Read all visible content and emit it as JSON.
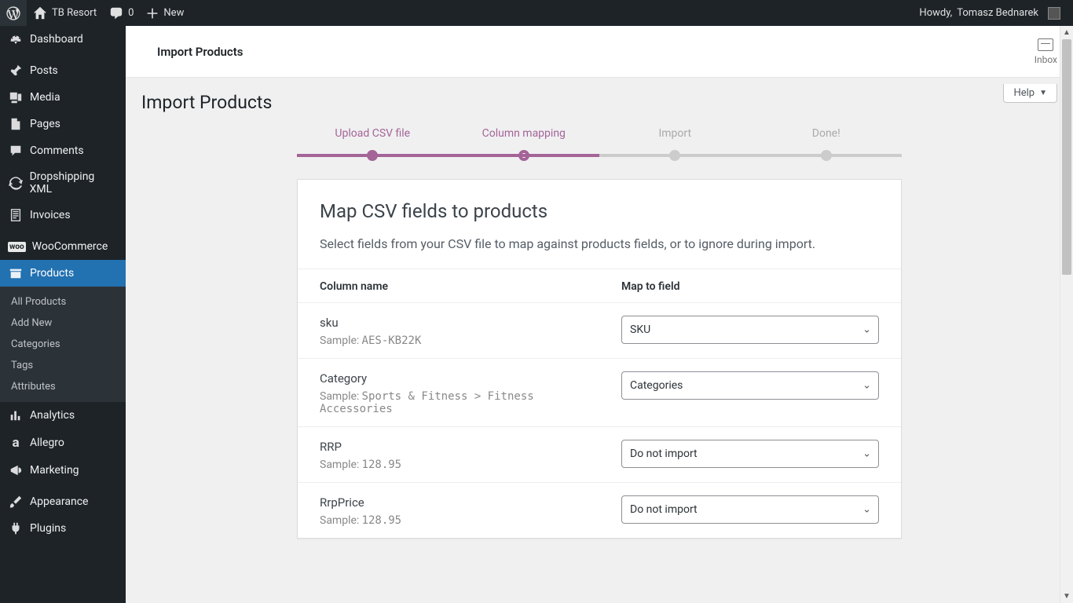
{
  "adminbar": {
    "site_name": "TB Resort",
    "comments_count": "0",
    "new_label": "New",
    "howdy_prefix": "Howdy, ",
    "user_display": "Tomasz Bednarek"
  },
  "sidebar": {
    "items": [
      {
        "label": "Dashboard",
        "icon": "dashboard"
      },
      {
        "label": "Posts",
        "icon": "pin"
      },
      {
        "label": "Media",
        "icon": "media"
      },
      {
        "label": "Pages",
        "icon": "page"
      },
      {
        "label": "Comments",
        "icon": "comment"
      },
      {
        "label": "Dropshipping XML",
        "icon": "refresh"
      },
      {
        "label": "Invoices",
        "icon": "invoice"
      },
      {
        "label": "WooCommerce",
        "icon": "woo"
      },
      {
        "label": "Products",
        "icon": "products",
        "current": true
      },
      {
        "label": "Analytics",
        "icon": "analytics"
      },
      {
        "label": "Allegro",
        "icon": "allegro"
      },
      {
        "label": "Marketing",
        "icon": "marketing"
      },
      {
        "label": "Appearance",
        "icon": "appearance"
      },
      {
        "label": "Plugins",
        "icon": "plugins"
      }
    ],
    "products_submenu": [
      {
        "label": "All Products"
      },
      {
        "label": "Add New"
      },
      {
        "label": "Categories"
      },
      {
        "label": "Tags"
      },
      {
        "label": "Attributes"
      }
    ]
  },
  "header": {
    "title": "Import Products",
    "inbox_label": "Inbox",
    "help_label": "Help"
  },
  "page": {
    "title": "Import Products"
  },
  "steps": [
    {
      "label": "Upload CSV file",
      "state": "done"
    },
    {
      "label": "Column mapping",
      "state": "active"
    },
    {
      "label": "Import",
      "state": "todo"
    },
    {
      "label": "Done!",
      "state": "todo"
    }
  ],
  "card": {
    "heading": "Map CSV fields to products",
    "description": "Select fields from your CSV file to map against products fields, or to ignore during import."
  },
  "table": {
    "col_name_header": "Column name",
    "map_to_header": "Map to field",
    "sample_label": "Sample:",
    "rows": [
      {
        "name": "sku",
        "sample": "AES-KB22K",
        "map": "SKU"
      },
      {
        "name": "Category",
        "sample": "Sports & Fitness > Fitness Accessories",
        "map": "Categories"
      },
      {
        "name": "RRP",
        "sample": "128.95",
        "map": "Do not import"
      },
      {
        "name": "RrpPrice",
        "sample": "128.95",
        "map": "Do not import"
      }
    ]
  }
}
